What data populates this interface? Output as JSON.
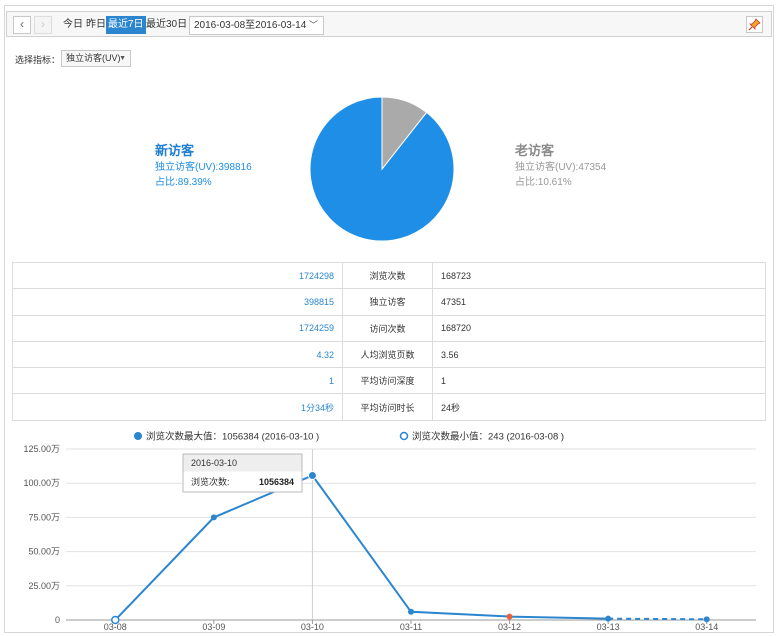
{
  "toolbar": {
    "prev_icon": "chevron-left-icon",
    "next_icon": "chevron-right-icon",
    "ranges": [
      "今日",
      "昨日",
      "最近7日",
      "最近30日"
    ],
    "active_range": "最近7日",
    "date_range": "2016-03-08至2016-03-14",
    "pin_icon": "pin-icon"
  },
  "metric": {
    "label": "选择指标：",
    "value": "独立访客(UV)"
  },
  "pie": {
    "new": {
      "title": "新访客",
      "uv": "独立访客(UV):398816",
      "share": "占比:89.39%",
      "percent": 89.39,
      "color": "#1f8ee6"
    },
    "old": {
      "title": "老访客",
      "uv": "独立访客(UV):47354",
      "share": "占比:10.61%",
      "percent": 10.61,
      "color": "#aaaaaa"
    }
  },
  "table": {
    "rows": [
      {
        "new": "1724298",
        "label": "浏览次数",
        "old": "168723"
      },
      {
        "new": "398815",
        "label": "独立访客",
        "old": "47351"
      },
      {
        "new": "1724259",
        "label": "访问次数",
        "old": "168720"
      },
      {
        "new": "4.32",
        "label": "人均浏览页数",
        "old": "3.56"
      },
      {
        "new": "1",
        "label": "平均访问深度",
        "old": "1"
      },
      {
        "new": "1分34秒",
        "label": "平均访问时长",
        "old": "24秒"
      }
    ]
  },
  "chart_data": {
    "type": "line",
    "legend_max": "浏览次数最大值：1056384 (2016-03-10 )",
    "legend_min": "浏览次数最小值：243 (2016-03-08 )",
    "categories": [
      "03-08",
      "03-09",
      "03-10",
      "03-11",
      "03-12",
      "03-13",
      "03-14"
    ],
    "y_tick_labels": [
      "0",
      "25.00万",
      "50.00万",
      "75.00万",
      "100.00万",
      "125.00万"
    ],
    "ylim": [
      0,
      1250000
    ],
    "series": [
      {
        "values": [
          243,
          750000,
          1056384,
          60000,
          25000,
          10000,
          5000
        ],
        "color": "#2b86cf"
      }
    ],
    "dashed_from_index": 5,
    "highlight_index": 4,
    "highlight_color": "#e8613c",
    "grid": true,
    "tooltip": {
      "date": "2016-03-10",
      "label": "浏览次数:",
      "value": "1056384",
      "index": 2
    }
  }
}
